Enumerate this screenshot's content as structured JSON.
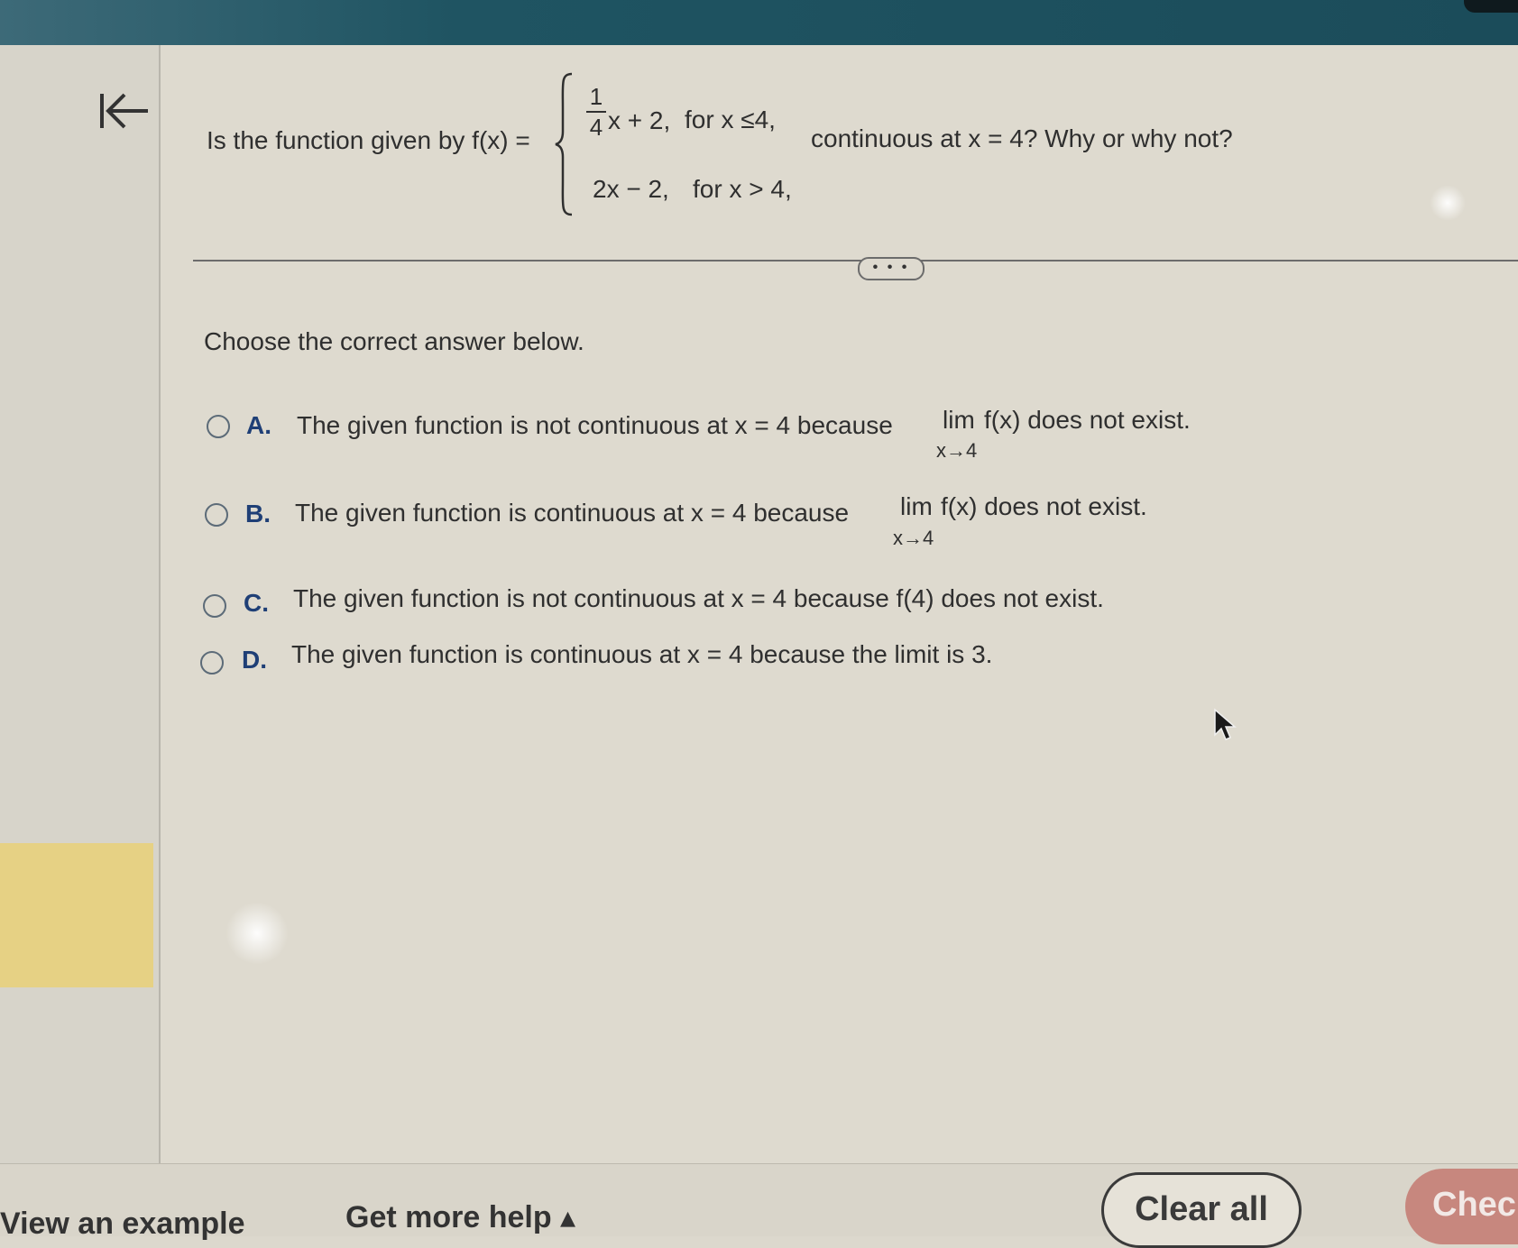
{
  "nav": {
    "back_icon": "collapse-left-icon"
  },
  "question": {
    "lead": "Is the function given by f(x) =",
    "piece1": {
      "num": "1",
      "den": "4",
      "expr": "x + 2,",
      "cond": "for x ≤4,"
    },
    "piece2": {
      "expr": "2x − 2,",
      "cond": "for x > 4,"
    },
    "tail": "continuous at x = 4? Why or why not?"
  },
  "divider": {
    "ellipsis": "• • •"
  },
  "prompt": "Choose the correct answer below.",
  "options": [
    {
      "letter": "A.",
      "text": "The given function is not continuous at x = 4 because",
      "lim": "lim",
      "tail": "f(x) does not exist.",
      "sub": "x→4"
    },
    {
      "letter": "B.",
      "text": "The given function is continuous at x = 4 because",
      "lim": "lim",
      "tail": "f(x) does not exist.",
      "sub": "x→4"
    },
    {
      "letter": "C.",
      "text": "The given function is not continuous at x = 4 because f(4) does not exist."
    },
    {
      "letter": "D.",
      "text": "The given function is continuous at x = 4 because the limit is 3."
    }
  ],
  "footer": {
    "view_example": "View an example",
    "get_more_help": "Get more help ▴",
    "clear_all": "Clear all",
    "check": "Chec"
  },
  "colors": {
    "accent": "#1f3f76",
    "topbar": "#1b4c5a",
    "check_button": "#c7877e"
  }
}
